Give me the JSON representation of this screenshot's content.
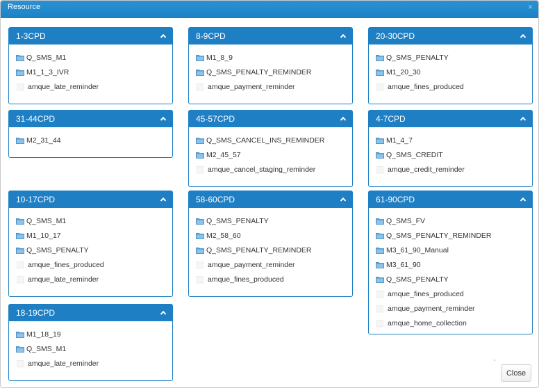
{
  "dialog": {
    "title": "Resource",
    "close_glyph": "×",
    "close_button": "Close"
  },
  "panels": [
    {
      "title": "1-3CPD",
      "items": [
        {
          "label": "Q_SMS_M1",
          "icon": "folder-icon"
        },
        {
          "label": "M1_1_3_IVR",
          "icon": "folder-icon"
        },
        {
          "label": "amque_late_reminder",
          "icon": "file-icon"
        }
      ]
    },
    {
      "title": "8-9CPD",
      "items": [
        {
          "label": "M1_8_9",
          "icon": "folder-icon"
        },
        {
          "label": "Q_SMS_PENALTY_REMINDER",
          "icon": "folder-icon"
        },
        {
          "label": "amque_payment_reminder",
          "icon": "file-icon"
        }
      ]
    },
    {
      "title": "20-30CPD",
      "items": [
        {
          "label": "Q_SMS_PENALTY",
          "icon": "folder-icon"
        },
        {
          "label": "M1_20_30",
          "icon": "folder-icon"
        },
        {
          "label": "amque_fines_produced",
          "icon": "file-icon"
        }
      ]
    },
    {
      "title": "31-44CPD",
      "items": [
        {
          "label": "M2_31_44",
          "icon": "folder-icon"
        }
      ]
    },
    {
      "title": "45-57CPD",
      "items": [
        {
          "label": "Q_SMS_CANCEL_INS_REMINDER",
          "icon": "folder-icon"
        },
        {
          "label": "M2_45_57",
          "icon": "folder-icon"
        },
        {
          "label": "amque_cancel_staging_reminder",
          "icon": "file-icon"
        }
      ]
    },
    {
      "title": "4-7CPD",
      "items": [
        {
          "label": "M1_4_7",
          "icon": "folder-icon"
        },
        {
          "label": "Q_SMS_CREDIT",
          "icon": "folder-icon"
        },
        {
          "label": "amque_credit_reminder",
          "icon": "file-icon"
        }
      ]
    },
    {
      "title": "10-17CPD",
      "items": [
        {
          "label": "Q_SMS_M1",
          "icon": "folder-icon"
        },
        {
          "label": "M1_10_17",
          "icon": "folder-icon"
        },
        {
          "label": "Q_SMS_PENALTY",
          "icon": "folder-icon"
        },
        {
          "label": "amque_fines_produced",
          "icon": "file-icon"
        },
        {
          "label": "amque_late_reminder",
          "icon": "file-icon"
        }
      ]
    },
    {
      "title": "58-60CPD",
      "items": [
        {
          "label": "Q_SMS_PENALTY",
          "icon": "folder-icon"
        },
        {
          "label": "M2_58_60",
          "icon": "folder-icon"
        },
        {
          "label": "Q_SMS_PENALTY_REMINDER",
          "icon": "folder-icon"
        },
        {
          "label": "amque_payment_reminder",
          "icon": "file-icon"
        },
        {
          "label": "amque_fines_produced",
          "icon": "file-icon"
        }
      ]
    },
    {
      "title": "61-90CPD",
      "items": [
        {
          "label": "Q_SMS_FV",
          "icon": "folder-icon"
        },
        {
          "label": "Q_SMS_PENALTY_REMINDER",
          "icon": "folder-icon"
        },
        {
          "label": "M3_61_90_Manual",
          "icon": "folder-icon"
        },
        {
          "label": "M3_61_90",
          "icon": "folder-icon"
        },
        {
          "label": "Q_SMS_PENALTY",
          "icon": "folder-icon"
        },
        {
          "label": "amque_fines_produced",
          "icon": "file-icon"
        },
        {
          "label": "amque_payment_reminder",
          "icon": "file-icon"
        },
        {
          "label": "amque_home_collection",
          "icon": "file-icon"
        }
      ]
    },
    {
      "title": "18-19CPD",
      "items": [
        {
          "label": "M1_18_19",
          "icon": "folder-icon"
        },
        {
          "label": "Q_SMS_M1",
          "icon": "folder-icon"
        },
        {
          "label": "amque_late_reminder",
          "icon": "file-icon"
        }
      ]
    }
  ]
}
